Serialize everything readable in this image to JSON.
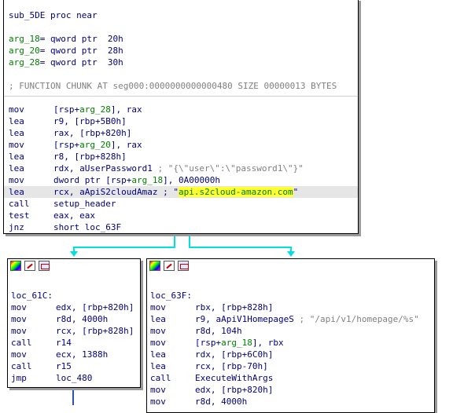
{
  "main_node": {
    "proc_header": "sub_5DE proc near",
    "args": [
      {
        "name": "arg_18",
        "rest": "= qword ptr  20h"
      },
      {
        "name": "arg_20",
        "rest": "= qword ptr  28h"
      },
      {
        "name": "arg_28",
        "rest": "= qword ptr  30h"
      }
    ],
    "chunk_comment": "; FUNCTION CHUNK AT seg000:0000000000000480 SIZE 00000013 BYTES",
    "instructions": [
      {
        "mn": "mov",
        "op": "[rsp+arg_28], rax"
      },
      {
        "mn": "lea",
        "op": "r9, [rbp+5B0h]"
      },
      {
        "mn": "lea",
        "op": "rax, [rbp+820h]"
      },
      {
        "mn": "mov",
        "op": "[rsp+arg_20], rax"
      },
      {
        "mn": "lea",
        "op": "r8, [rbp+828h]"
      },
      {
        "mn": "lea",
        "op": "rdx, aUserPassword1 ; \"{\\\"user\\\":\\\"password1\\\"}\""
      },
      {
        "mn": "mov",
        "op": "dword ptr [rsp+arg_18], 0A00000h"
      },
      {
        "mn": "lea",
        "op_pre": "rcx, aApiS2cloudAmaz ; \"",
        "op_hl": "api.s2cloud-amazon.com",
        "op_post": "\""
      },
      {
        "mn": "call",
        "op": "setup_header"
      },
      {
        "mn": "test",
        "op": "eax, eax"
      },
      {
        "mn": "jnz",
        "op": "short loc_63F"
      }
    ]
  },
  "left_node": {
    "label": "loc_61C:",
    "instructions": [
      {
        "mn": "mov",
        "op": "edx, [rbp+820h]"
      },
      {
        "mn": "mov",
        "op": "r8d, 4000h"
      },
      {
        "mn": "mov",
        "op": "rcx, [rbp+828h]"
      },
      {
        "mn": "call",
        "op": "r14"
      },
      {
        "mn": "mov",
        "op": "ecx, 1388h"
      },
      {
        "mn": "call",
        "op": "r15"
      },
      {
        "mn": "jmp",
        "op": "loc_480"
      }
    ]
  },
  "right_node": {
    "label": "loc_63F:",
    "instructions": [
      {
        "mn": "mov",
        "op": "rbx, [rbp+828h]"
      },
      {
        "mn": "lea",
        "op": "r9, aApiV1HomepageS ; \"/api/v1/homepage/%s\""
      },
      {
        "mn": "mov",
        "op": "r8d, 104h"
      },
      {
        "mn": "mov",
        "op": "[rsp+arg_18], rbx"
      },
      {
        "mn": "lea",
        "op": "rdx, [rbp+6C0h]"
      },
      {
        "mn": "lea",
        "op": "rcx, [rbp-70h]"
      },
      {
        "mn": "call",
        "op": "ExecuteWithArgs"
      },
      {
        "mn": "mov",
        "op": "edx, [rbp+820h]"
      },
      {
        "mn": "mov",
        "op": "r8d, 4000h"
      }
    ]
  },
  "icons": [
    "color-palette-icon",
    "edit-color-icon",
    "graph-view-icon"
  ],
  "colors": {
    "edge": "#00e0e0",
    "highlight": "#ffff33",
    "text": "#000080",
    "arg": "#008000",
    "comment": "#808080"
  }
}
